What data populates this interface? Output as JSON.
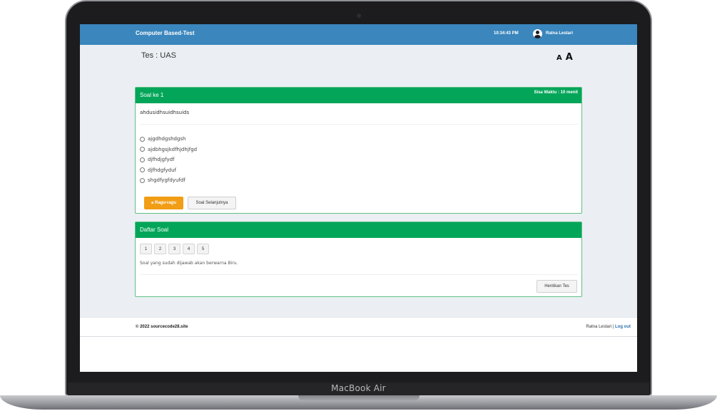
{
  "device": {
    "label": "MacBook Air"
  },
  "header": {
    "title": "Computer Based-Test",
    "time": "10:34:43 PM",
    "user_name": "Ratna Lestari"
  },
  "test": {
    "title": "Tes : UAS",
    "font_small": "A",
    "font_large": "A"
  },
  "question": {
    "heading": "Soal ke 1",
    "timer": "Sisa Waktu : 10 menit",
    "text": "ahdusidhsuidhsuids",
    "options": [
      "ajgdhdgshdgsh",
      "ajdbhgsjkdfhjdhjfgd",
      "djfhdjgfydf",
      "djfhdgfyduf",
      "shgdfygfdyufdf"
    ],
    "doubt_label": "Ragu-ragu",
    "next_label": "Soal Selanjutnya"
  },
  "question_list": {
    "heading": "Daftar Soal",
    "numbers": [
      "1",
      "2",
      "3",
      "4",
      "5"
    ],
    "hint": "Soal yang sudah dijawab akan berwarna Biru.",
    "stop_label": "Hentikan Tes"
  },
  "footer": {
    "copyright": "© 2022 sourcecode28.site",
    "user_name": "Ratna Lestari",
    "separator": " | ",
    "logout_label": "Log out"
  }
}
